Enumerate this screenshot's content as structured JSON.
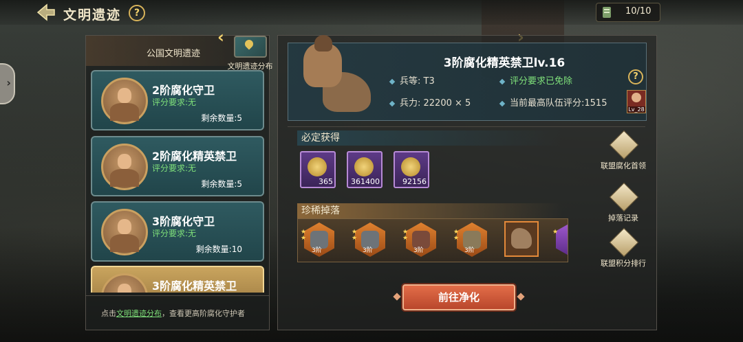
{
  "header": {
    "title": "文明遗迹",
    "help_icon": "?",
    "stamina": "10/10"
  },
  "left": {
    "header_label": "公国文明遗迹",
    "distribution_label": "文明遗迹分布",
    "cards": [
      {
        "name": "2阶腐化守卫",
        "req": "评分要求:无",
        "remain": "剩余数量:5"
      },
      {
        "name": "2阶腐化精英禁卫",
        "req": "评分要求:无",
        "remain": "剩余数量:5"
      },
      {
        "name": "3阶腐化守卫",
        "req": "评分要求:无",
        "remain": "剩余数量:10"
      },
      {
        "name": "3阶腐化精英禁卫",
        "req": "",
        "remain": ""
      }
    ],
    "footer": {
      "prefix": "点击",
      "link": "文明遗迹分布",
      "suffix": "，查看更高阶腐化守护者"
    }
  },
  "boss": {
    "name": "3阶腐化精英禁卫lv.16",
    "tier_label": "兵等: T3",
    "score_req": "评分要求已免除",
    "troops": "兵力: 22200 × 5",
    "max_score": "当前最高队伍评分:1515",
    "avatar_level": "Lv_28"
  },
  "sure_drop": {
    "title": "必定获得",
    "items": [
      {
        "icon": "medal-icon",
        "count": "365"
      },
      {
        "icon": "gold-coins-icon",
        "count": "361400"
      },
      {
        "icon": "gold-coins-up-icon",
        "count": "92156"
      }
    ]
  },
  "rare_drop": {
    "title": "珍稀掉落",
    "items": [
      {
        "icon": "armor-icon",
        "tier": "3阶"
      },
      {
        "icon": "helmet-icon",
        "tier": "3阶"
      },
      {
        "icon": "book-icon",
        "tier": "3阶"
      },
      {
        "icon": "horn-icon",
        "tier": "3阶"
      }
    ]
  },
  "actions": [
    {
      "icon": "alliance-boss-icon",
      "label": "联盟腐化首领"
    },
    {
      "icon": "drop-record-icon",
      "label": "掉落记录"
    },
    {
      "icon": "alliance-rank-icon",
      "label": "联盟积分排行"
    }
  ],
  "go_button": "前往净化",
  "colors": {
    "accent_green": "#7fe07a",
    "gold": "#f3d26e",
    "go_button": "#c9552f"
  }
}
